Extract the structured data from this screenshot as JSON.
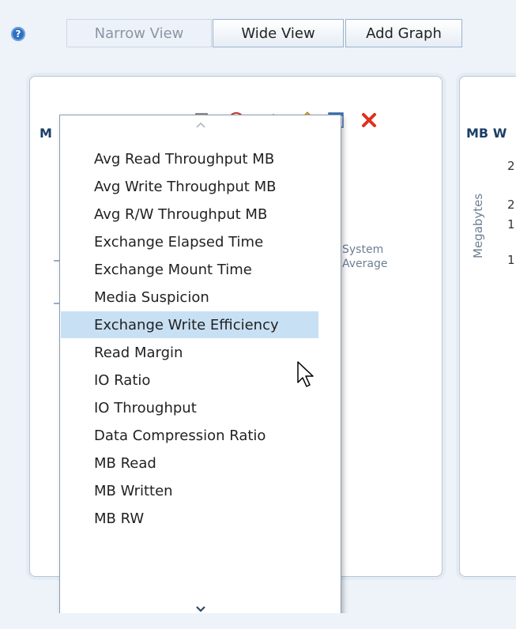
{
  "toolbar": {
    "help_glyph": "?",
    "narrow_view": "Narrow View",
    "wide_view": "Wide View",
    "add_graph": "Add Graph"
  },
  "left_panel": {
    "title_fragment": "M",
    "legend_line1": "System",
    "legend_line2": "Average",
    "icons": [
      "calendar-chart-icon",
      "clock-icon",
      "percent-icon",
      "pencil-icon",
      "chart-edit-icon",
      "delete-icon"
    ]
  },
  "right_panel": {
    "title_fragment": "MB W",
    "y_axis_label": "Megabytes",
    "tick_fragments": [
      "2",
      "2",
      "1",
      "1"
    ]
  },
  "dropdown": {
    "items": [
      "Avg Read Throughput MB",
      "Avg Write Throughput MB",
      "Avg R/W Throughput MB",
      "Exchange Elapsed Time",
      "Exchange Mount Time",
      "Media Suspicion",
      "Exchange Write Efficiency",
      "Read Margin",
      "IO Ratio",
      "IO Throughput",
      "Data Compression Ratio",
      "MB Read",
      "MB Written",
      "MB RW"
    ],
    "selected": "Exchange Write Efficiency"
  },
  "colors": {
    "accent": "#1b3f66",
    "selection": "#c8e0f4",
    "delete_icon": "#e0301e"
  }
}
